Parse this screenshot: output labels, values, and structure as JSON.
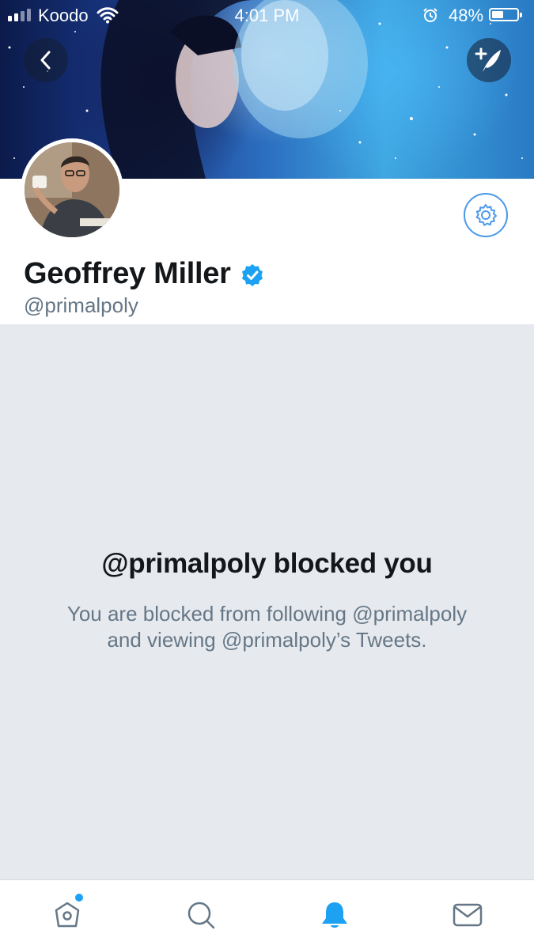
{
  "status_bar": {
    "carrier": "Koodo",
    "time": "4:01 PM",
    "battery_percent": "48%",
    "battery_level": 0.48
  },
  "header": {
    "back_icon": "chevron-left-icon",
    "compose_icon": "compose-tweet-icon"
  },
  "profile": {
    "name": "Geoffrey Miller",
    "handle": "@primalpoly",
    "verified": true,
    "settings_icon": "gear-icon"
  },
  "blocked": {
    "title": "@primalpoly blocked you",
    "line1": "You are blocked from following @primalpoly",
    "line2": "and viewing @primalpoly’s Tweets."
  },
  "tabbar": {
    "items": [
      {
        "name": "home",
        "icon": "home-icon",
        "has_notification_dot": true
      },
      {
        "name": "search",
        "icon": "search-icon"
      },
      {
        "name": "notifications",
        "icon": "bell-icon",
        "active": true
      },
      {
        "name": "messages",
        "icon": "envelope-icon"
      }
    ],
    "active_color": "#1da1f2",
    "inactive_color": "#657786"
  }
}
